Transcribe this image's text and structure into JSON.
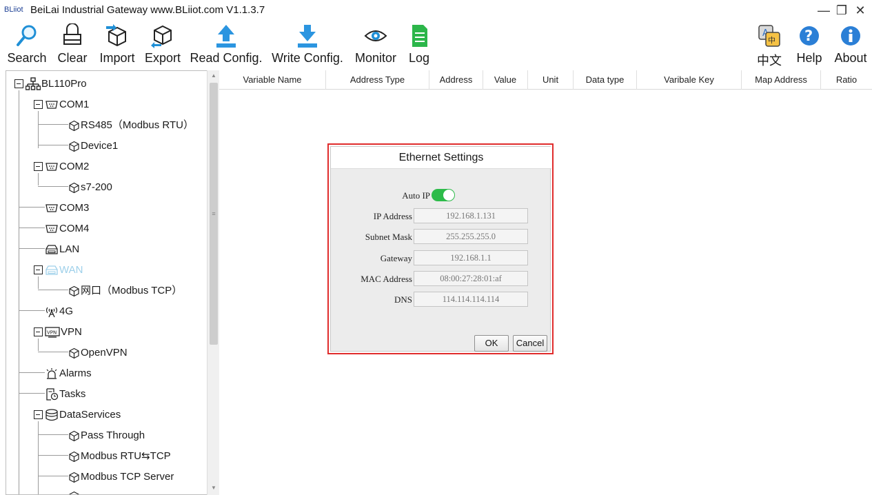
{
  "titlebar": {
    "brand": "BLiiot",
    "title": "BeiLai Industrial Gateway www.BLiiot.com V1.1.3.7",
    "minimize": "—",
    "restore": "❐",
    "close": "✕"
  },
  "toolbar": {
    "search": "Search",
    "clear": "Clear",
    "import": "Import",
    "export": "Export",
    "read_config": "Read Config.",
    "write_config": "Write Config.",
    "monitor": "Monitor",
    "log": "Log",
    "language": "中文",
    "help": "Help",
    "about": "About"
  },
  "tree": {
    "root": "BL110Pro",
    "com1": "COM1",
    "rs485": "RS485（Modbus RTU）",
    "device1": "Device1",
    "com2": "COM2",
    "s7200": "s7-200",
    "com3": "COM3",
    "com4": "COM4",
    "lan": "LAN",
    "wan": "WAN",
    "wan_port": "网口（Modbus TCP）",
    "g4": "4G",
    "vpn": "VPN",
    "openvpn": "OpenVPN",
    "alarms": "Alarms",
    "tasks": "Tasks",
    "dataservices": "DataServices",
    "pass_through": "Pass Through",
    "modbus_rtu_tcp": "Modbus RTU⇆TCP",
    "modbus_tcp_server": "Modbus TCP Server"
  },
  "columns": [
    "Variable Name",
    "Address Type",
    "Address",
    "Value",
    "Unit",
    "Data type",
    "Varibale Key",
    "Map Address",
    "Ratio"
  ],
  "dialog": {
    "title": "Ethernet Settings",
    "auto_ip_label": "Auto IP",
    "auto_ip_on": true,
    "ip_label": "IP Address",
    "ip_value": "192.168.1.131",
    "subnet_label": "Subnet Mask",
    "subnet_value": "255.255.255.0",
    "gateway_label": "Gateway",
    "gateway_value": "192.168.1.1",
    "mac_label": "MAC Address",
    "mac_value": "08:00:27:28:01:af",
    "dns_label": "DNS",
    "dns_value": "114.114.114.114",
    "ok": "OK",
    "cancel": "Cancel"
  },
  "colors": {
    "highlight_border": "#e02b2b",
    "toggle_on": "#2dbb4a",
    "brand": "#1c3f94",
    "wan_disabled": "#9ed0ea"
  }
}
